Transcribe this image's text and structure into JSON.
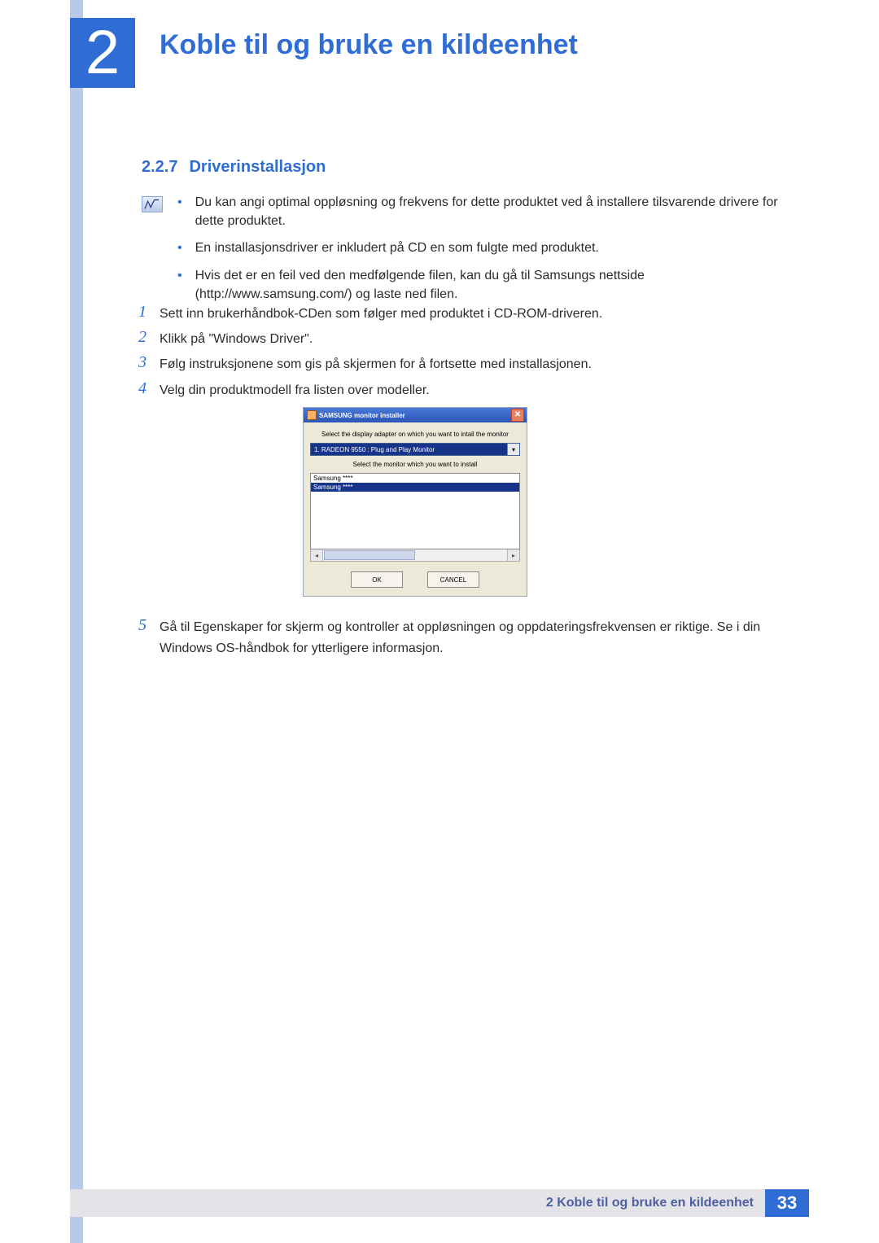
{
  "chapter": {
    "number": "2",
    "title": "Koble til og bruke en kildeenhet"
  },
  "section": {
    "number": "2.2.7",
    "title": "Driverinstallasjon"
  },
  "notes": [
    "Du kan angi optimal oppløsning og frekvens for dette produktet ved å installere tilsvarende drivere for dette produktet.",
    "En installasjonsdriver er inkludert på CD en som fulgte med produktet.",
    "Hvis det er en feil ved den medfølgende filen, kan du gå til Samsungs nettside (http://www.samsung.com/) og laste ned filen."
  ],
  "steps": {
    "s1": {
      "num": "1",
      "text": "Sett inn brukerhåndbok-CDen som følger med produktet i CD-ROM-driveren."
    },
    "s2": {
      "num": "2",
      "text": "Klikk på \"Windows Driver\"."
    },
    "s3": {
      "num": "3",
      "text": "Følg instruksjonene som gis på skjermen for å fortsette med installasjonen."
    },
    "s4": {
      "num": "4",
      "text": "Velg din produktmodell fra listen over modeller."
    },
    "s5": {
      "num": "5",
      "text": "Gå til Egenskaper for skjerm og kontroller at oppløsningen og oppdateringsfrekvensen er riktige. Se i din Windows OS-håndbok for ytterligere informasjon."
    }
  },
  "dialog": {
    "title": "SAMSUNG monitor installer",
    "label_adapter": "Select the display adapter on which you want to intall the monitor",
    "adapter_value": "1. RADEON 9550 : Plug and Play Monitor",
    "label_monitor": "Select the monitor which you want to install",
    "list_item_normal": "Samsung ****",
    "list_item_selected": "Samsung ****",
    "ok": "OK",
    "cancel": "CANCEL"
  },
  "footer": {
    "text": "2 Koble til og bruke en kildeenhet",
    "page": "33"
  }
}
